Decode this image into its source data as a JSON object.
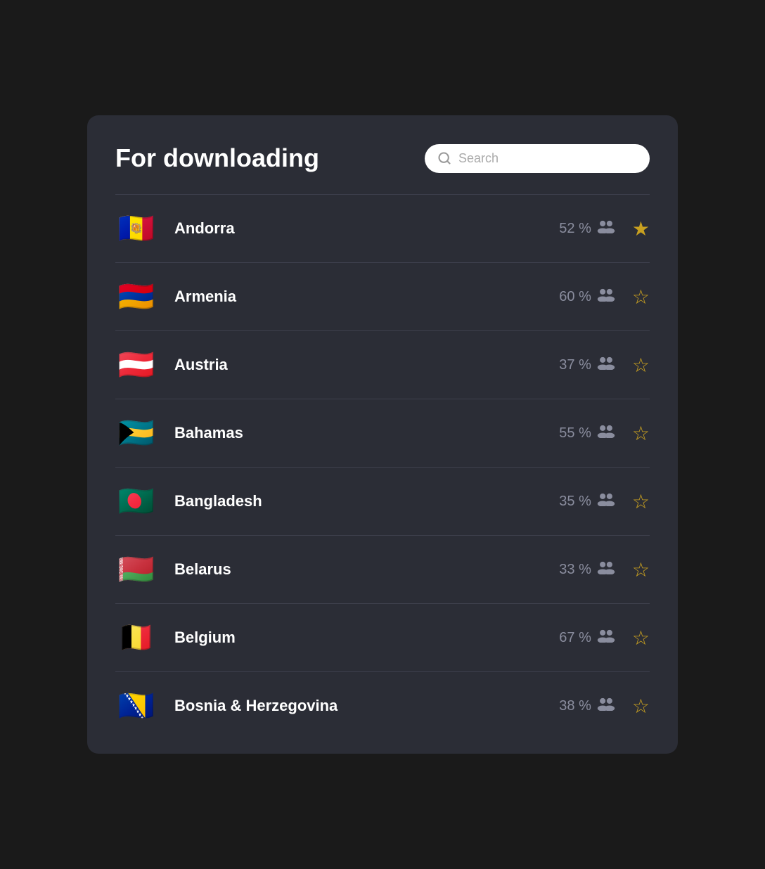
{
  "header": {
    "title": "For downloading",
    "search_placeholder": "Search"
  },
  "countries": [
    {
      "name": "Andorra",
      "percent": "52 %",
      "flag_class": "flag-andorra",
      "flag_emoji": "🇦🇩",
      "starred": true
    },
    {
      "name": "Armenia",
      "percent": "60 %",
      "flag_class": "flag-armenia",
      "flag_emoji": "🇦🇲",
      "starred": false
    },
    {
      "name": "Austria",
      "percent": "37 %",
      "flag_class": "flag-austria",
      "flag_emoji": "🇦🇹",
      "starred": false
    },
    {
      "name": "Bahamas",
      "percent": "55 %",
      "flag_class": "flag-bahamas",
      "flag_emoji": "🇧🇸",
      "starred": false
    },
    {
      "name": "Bangladesh",
      "percent": "35 %",
      "flag_class": "flag-bangladesh",
      "flag_emoji": "🇧🇩",
      "starred": false
    },
    {
      "name": "Belarus",
      "percent": "33 %",
      "flag_class": "flag-belarus",
      "flag_emoji": "🇧🇾",
      "starred": false
    },
    {
      "name": "Belgium",
      "percent": "67 %",
      "flag_class": "flag-belgium",
      "flag_emoji": "🇧🇪",
      "starred": false
    },
    {
      "name": "Bosnia & Herzegovina",
      "percent": "38 %",
      "flag_class": "flag-bosnia",
      "flag_emoji": "🇧🇦",
      "starred": false
    }
  ],
  "icons": {
    "search": "🔍",
    "people": "👥",
    "star_filled": "★",
    "star_empty": "☆"
  }
}
